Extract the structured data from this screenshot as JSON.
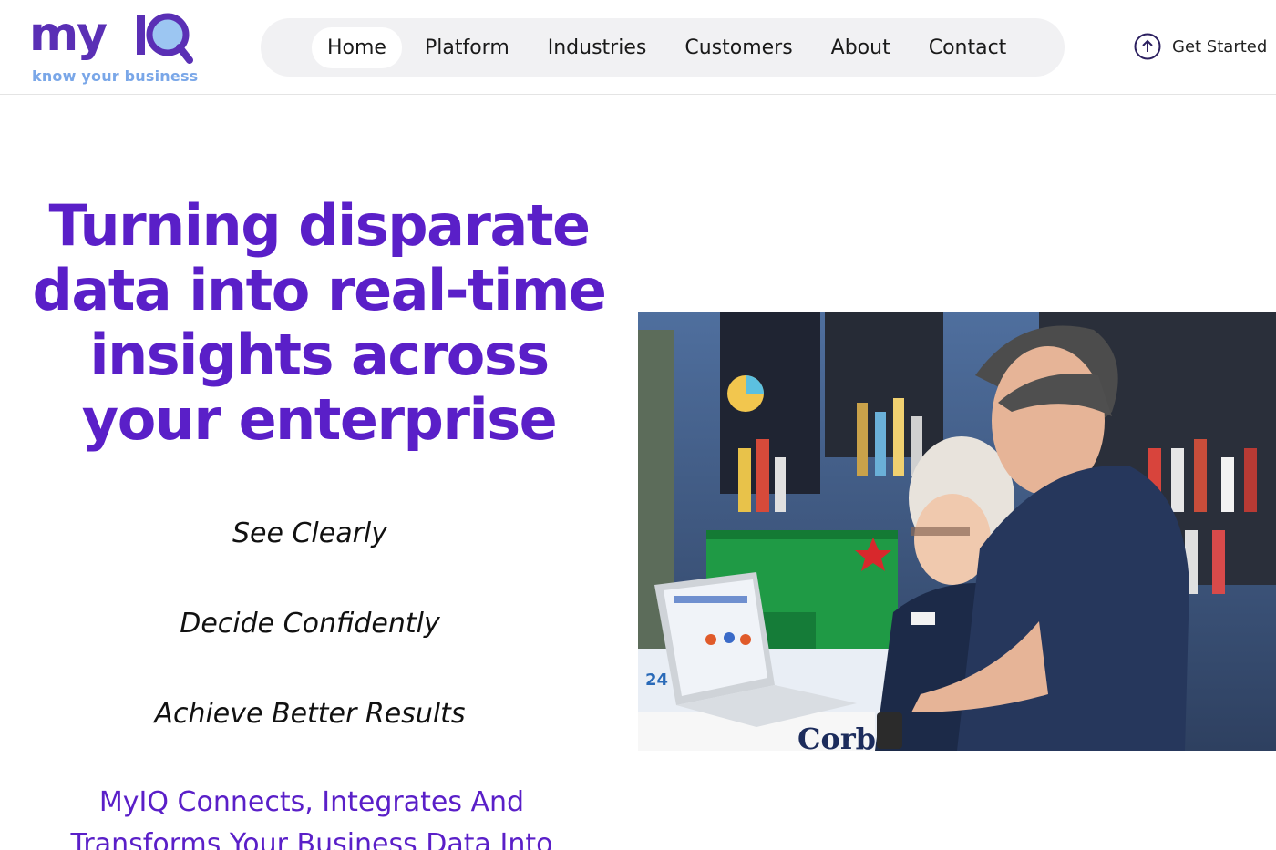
{
  "brand": {
    "name": "myIQ",
    "wordmark": "my",
    "tagline": "know your business",
    "primary_color": "#5a1fc8",
    "accent_color": "#7aa7e8"
  },
  "nav": {
    "items": [
      {
        "label": "Home",
        "active": true
      },
      {
        "label": "Platform",
        "active": false
      },
      {
        "label": "Industries",
        "active": false
      },
      {
        "label": "Customers",
        "active": false
      },
      {
        "label": "About",
        "active": false
      },
      {
        "label": "Contact",
        "active": false
      }
    ]
  },
  "cta": {
    "label": "Get Started",
    "icon": "arrow-up-circle-icon"
  },
  "hero": {
    "headline": "Turning disparate data into real-time insights across your enterprise",
    "taglines": [
      "See Clearly",
      "Decide Confidently",
      "Achieve Better Results"
    ],
    "subheadline": "MyIQ Connects, Integrates And Transforms Your Business Data Into",
    "image": "photo-store-staff-laptop"
  }
}
